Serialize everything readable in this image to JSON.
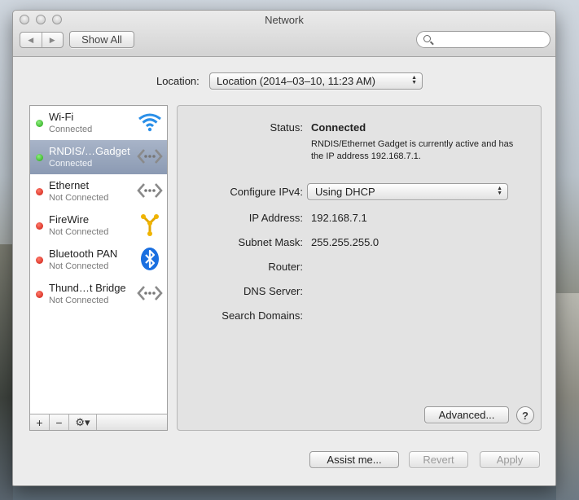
{
  "window": {
    "title": "Network"
  },
  "toolbar": {
    "back_glyph": "◀",
    "forward_glyph": "▶",
    "show_all_label": "Show All",
    "search_placeholder": ""
  },
  "location": {
    "label": "Location:",
    "value": "Location (2014–03–10, 11:23 AM)"
  },
  "services": [
    {
      "name": "Wi-Fi",
      "status": "Connected",
      "dot": "green",
      "icon": "wifi-icon",
      "selected": false
    },
    {
      "name": "RNDIS/…Gadget",
      "status": "Connected",
      "dot": "green",
      "icon": "ethernet-icon",
      "selected": true
    },
    {
      "name": "Ethernet",
      "status": "Not Connected",
      "dot": "red",
      "icon": "ethernet-icon",
      "selected": false
    },
    {
      "name": "FireWire",
      "status": "Not Connected",
      "dot": "red",
      "icon": "firewire-icon",
      "selected": false
    },
    {
      "name": "Bluetooth PAN",
      "status": "Not Connected",
      "dot": "red",
      "icon": "bluetooth-icon",
      "selected": false
    },
    {
      "name": "Thund…t Bridge",
      "status": "Not Connected",
      "dot": "red",
      "icon": "ethernet-icon",
      "selected": false
    }
  ],
  "sidebar_tools": {
    "add": "+",
    "remove": "−",
    "gear": "⚙▾"
  },
  "detail": {
    "status_label": "Status:",
    "status_value": "Connected",
    "status_desc": "RNDIS/Ethernet Gadget is currently active and has the IP address 192.168.7.1.",
    "configure_label": "Configure IPv4:",
    "configure_value": "Using DHCP",
    "ip_label": "IP Address:",
    "ip_value": "192.168.7.1",
    "subnet_label": "Subnet Mask:",
    "subnet_value": "255.255.255.0",
    "router_label": "Router:",
    "dns_label": "DNS Server:",
    "search_domains_label": "Search Domains:",
    "advanced_label": "Advanced...",
    "help_label": "?"
  },
  "footer": {
    "assist_label": "Assist me...",
    "revert_label": "Revert",
    "apply_label": "Apply"
  },
  "colors": {
    "selection": "#8b9ab3",
    "connected": "#21a114",
    "disconnected": "#cb1a10",
    "bluetooth": "#1a6fe0",
    "firewire": "#f0b400"
  }
}
